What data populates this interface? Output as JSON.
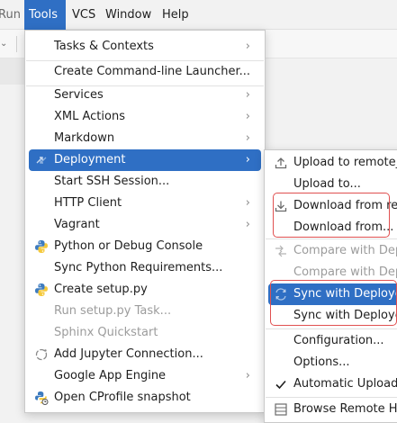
{
  "menubar": {
    "items": [
      "Run",
      "Tools",
      "VCS",
      "Window",
      "Help"
    ]
  },
  "tools_menu": {
    "items": [
      {
        "label": "Tasks & Contexts",
        "submenu": true
      },
      {
        "label": "Create Command-line Launcher...",
        "submenu": false
      },
      {
        "label": "Services",
        "submenu": true
      },
      {
        "label": "XML Actions",
        "submenu": true
      },
      {
        "label": "Markdown",
        "submenu": true
      },
      {
        "label": "Deployment",
        "submenu": true,
        "selected": true,
        "icon": "deployment-icon"
      },
      {
        "label": "Start SSH Session...",
        "submenu": false
      },
      {
        "label": "HTTP Client",
        "submenu": true
      },
      {
        "label": "Vagrant",
        "submenu": true
      },
      {
        "label": "Python or Debug Console",
        "submenu": false,
        "icon": "python-icon"
      },
      {
        "label": "Sync Python Requirements...",
        "submenu": false
      },
      {
        "label": "Create setup.py",
        "submenu": false,
        "icon": "python-icon"
      },
      {
        "label": "Run setup.py Task...",
        "submenu": false,
        "disabled": true
      },
      {
        "label": "Sphinx Quickstart",
        "submenu": false,
        "disabled": true
      },
      {
        "label": "Add Jupyter Connection...",
        "submenu": false,
        "icon": "jupyter-icon"
      },
      {
        "label": "Google App Engine",
        "submenu": true
      },
      {
        "label": "Open CProfile snapshot",
        "submenu": false,
        "icon": "cprofile-icon"
      }
    ]
  },
  "deployment_menu": {
    "items": [
      {
        "label": "Upload to remote_",
        "icon": "upload-icon"
      },
      {
        "label": "Upload to..."
      },
      {
        "label": "Download from rer",
        "icon": "download-icon"
      },
      {
        "label": "Download from..."
      },
      {
        "label": "Compare with Dep",
        "disabled": true,
        "icon": "compare-icon"
      },
      {
        "label": "Compare with Dep",
        "disabled": true
      },
      {
        "label": "Sync with Deploye",
        "selected": true,
        "icon": "sync-icon"
      },
      {
        "label": "Sync with Deploye"
      },
      {
        "label": "Configuration..."
      },
      {
        "label": "Options..."
      },
      {
        "label": "Automatic Upload",
        "checked": true
      },
      {
        "label": "Browse Remote Ho",
        "icon": "browse-remote-icon"
      }
    ]
  },
  "colors": {
    "accent": "#2f6fc4",
    "highlight_box": "#e05050",
    "disabled_text": "#9c9c9c"
  }
}
